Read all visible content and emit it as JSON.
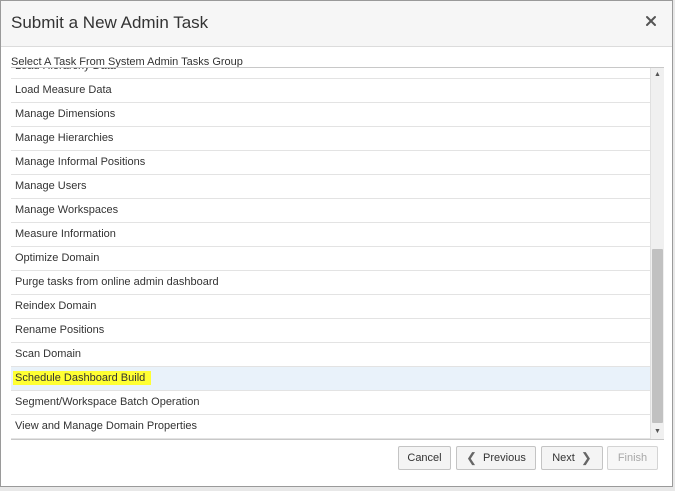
{
  "dialog": {
    "title": "Submit a New Admin Task",
    "subtitle": "Select A Task From System Admin Tasks Group"
  },
  "icons": {
    "close": "close-icon",
    "scroll_up": "scroll-up-arrow-icon",
    "scroll_down": "scroll-down-arrow-icon",
    "previous": "chevron-left-icon",
    "next": "chevron-right-icon"
  },
  "tasks": [
    "Load Hierarchy Data",
    "Load Measure Data",
    "Manage Dimensions",
    "Manage Hierarchies",
    "Manage Informal Positions",
    "Manage Users",
    "Manage Workspaces",
    "Measure Information",
    "Optimize Domain",
    "Purge tasks from online admin dashboard",
    "Reindex Domain",
    "Rename Positions",
    "Scan Domain",
    "Schedule Dashboard Build",
    "Segment/Workspace Batch Operation",
    "View and Manage Domain Properties"
  ],
  "selected_task": "Schedule Dashboard Build",
  "buttons": {
    "cancel": "Cancel",
    "previous": "Previous",
    "next": "Next",
    "finish": "Finish"
  },
  "colors": {
    "selected_row_bg": "#e9f2fa",
    "highlight": "#ffff33"
  }
}
